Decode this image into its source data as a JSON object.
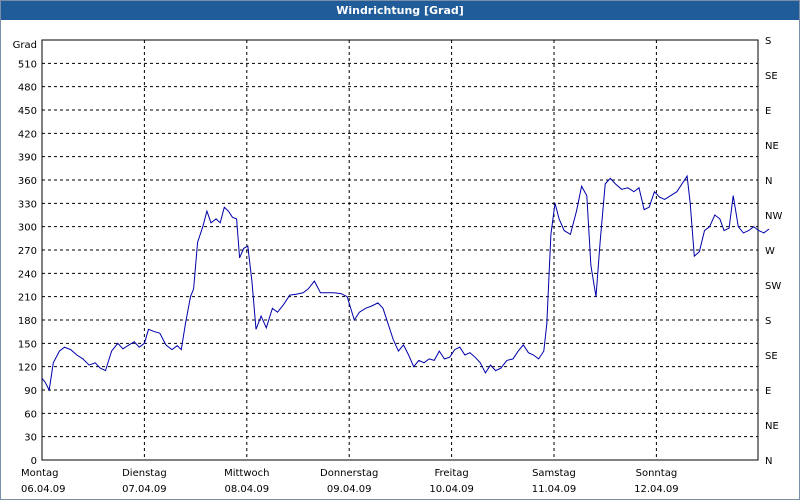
{
  "window": {
    "title": "Windrichtung [Grad]"
  },
  "chart_data": {
    "type": "line",
    "title": "Windrichtung [Grad]",
    "ylabel": "Grad",
    "ylim": [
      0,
      540
    ],
    "y_ticks": [
      0,
      30,
      60,
      90,
      120,
      150,
      180,
      210,
      240,
      270,
      300,
      330,
      360,
      390,
      420,
      450,
      480,
      510
    ],
    "y2_labels": [
      "N",
      "NE",
      "E",
      "SE",
      "S",
      "SW",
      "W",
      "NW",
      "N",
      "NE",
      "E",
      "SE",
      "S"
    ],
    "x_range": [
      0,
      7
    ],
    "x_ticks": [
      {
        "x": 0,
        "day": "Montag",
        "date": "06.04.09"
      },
      {
        "x": 1,
        "day": "Dienstag",
        "date": "07.04.09"
      },
      {
        "x": 2,
        "day": "Mittwoch",
        "date": "08.04.09"
      },
      {
        "x": 3,
        "day": "Donnerstag",
        "date": "09.04.09"
      },
      {
        "x": 4,
        "day": "Freitag",
        "date": "10.04.09"
      },
      {
        "x": 5,
        "day": "Samstag",
        "date": "11.04.09"
      },
      {
        "x": 6,
        "day": "Sonntag",
        "date": "12.04.09"
      }
    ],
    "grid": true,
    "colors": {
      "line": "#0000aa",
      "grid": "#000000",
      "titlebar": "#1f5c99"
    },
    "series": [
      {
        "points": [
          [
            0.0,
            105
          ],
          [
            0.03,
            100
          ],
          [
            0.07,
            90
          ],
          [
            0.11,
            125
          ],
          [
            0.17,
            140
          ],
          [
            0.22,
            145
          ],
          [
            0.28,
            142
          ],
          [
            0.34,
            135
          ],
          [
            0.4,
            130
          ],
          [
            0.46,
            122
          ],
          [
            0.52,
            125
          ],
          [
            0.57,
            118
          ],
          [
            0.62,
            115
          ],
          [
            0.68,
            140
          ],
          [
            0.74,
            150
          ],
          [
            0.79,
            143
          ],
          [
            0.85,
            148
          ],
          [
            0.9,
            152
          ],
          [
            0.95,
            145
          ],
          [
            1.0,
            150
          ],
          [
            1.04,
            168
          ],
          [
            1.1,
            165
          ],
          [
            1.15,
            163
          ],
          [
            1.21,
            148
          ],
          [
            1.27,
            142
          ],
          [
            1.32,
            147
          ],
          [
            1.36,
            142
          ],
          [
            1.4,
            175
          ],
          [
            1.45,
            210
          ],
          [
            1.48,
            220
          ],
          [
            1.52,
            280
          ],
          [
            1.57,
            300
          ],
          [
            1.61,
            320
          ],
          [
            1.65,
            305
          ],
          [
            1.7,
            310
          ],
          [
            1.74,
            305
          ],
          [
            1.78,
            325
          ],
          [
            1.82,
            320
          ],
          [
            1.86,
            312
          ],
          [
            1.9,
            310
          ],
          [
            1.93,
            260
          ],
          [
            1.97,
            272
          ],
          [
            2.01,
            275
          ],
          [
            2.05,
            230
          ],
          [
            2.09,
            168
          ],
          [
            2.14,
            185
          ],
          [
            2.19,
            170
          ],
          [
            2.25,
            195
          ],
          [
            2.3,
            190
          ],
          [
            2.36,
            200
          ],
          [
            2.42,
            212
          ],
          [
            2.48,
            213
          ],
          [
            2.55,
            215
          ],
          [
            2.6,
            220
          ],
          [
            2.66,
            230
          ],
          [
            2.72,
            215
          ],
          [
            2.78,
            215
          ],
          [
            2.85,
            215
          ],
          [
            2.92,
            214
          ],
          [
            2.98,
            210
          ],
          [
            3.05,
            180
          ],
          [
            3.1,
            190
          ],
          [
            3.16,
            195
          ],
          [
            3.22,
            198
          ],
          [
            3.28,
            202
          ],
          [
            3.33,
            195
          ],
          [
            3.38,
            175
          ],
          [
            3.43,
            155
          ],
          [
            3.48,
            140
          ],
          [
            3.53,
            148
          ],
          [
            3.58,
            135
          ],
          [
            3.63,
            120
          ],
          [
            3.68,
            128
          ],
          [
            3.73,
            125
          ],
          [
            3.78,
            130
          ],
          [
            3.83,
            128
          ],
          [
            3.88,
            140
          ],
          [
            3.93,
            130
          ],
          [
            3.98,
            132
          ],
          [
            4.03,
            142
          ],
          [
            4.08,
            145
          ],
          [
            4.13,
            135
          ],
          [
            4.18,
            138
          ],
          [
            4.23,
            132
          ],
          [
            4.28,
            125
          ],
          [
            4.33,
            112
          ],
          [
            4.38,
            122
          ],
          [
            4.43,
            115
          ],
          [
            4.48,
            118
          ],
          [
            4.54,
            128
          ],
          [
            4.6,
            130
          ],
          [
            4.65,
            140
          ],
          [
            4.7,
            148
          ],
          [
            4.75,
            138
          ],
          [
            4.8,
            135
          ],
          [
            4.85,
            130
          ],
          [
            4.9,
            140
          ],
          [
            4.93,
            175
          ],
          [
            4.97,
            290
          ],
          [
            5.01,
            330
          ],
          [
            5.05,
            310
          ],
          [
            5.1,
            295
          ],
          [
            5.16,
            290
          ],
          [
            5.22,
            320
          ],
          [
            5.27,
            352
          ],
          [
            5.32,
            340
          ],
          [
            5.36,
            250
          ],
          [
            5.41,
            210
          ],
          [
            5.45,
            280
          ],
          [
            5.5,
            355
          ],
          [
            5.55,
            362
          ],
          [
            5.6,
            355
          ],
          [
            5.66,
            348
          ],
          [
            5.72,
            350
          ],
          [
            5.78,
            345
          ],
          [
            5.83,
            350
          ],
          [
            5.88,
            322
          ],
          [
            5.93,
            325
          ],
          [
            5.98,
            345
          ],
          [
            6.03,
            338
          ],
          [
            6.08,
            335
          ],
          [
            6.14,
            340
          ],
          [
            6.2,
            345
          ],
          [
            6.25,
            355
          ],
          [
            6.3,
            365
          ],
          [
            6.33,
            330
          ],
          [
            6.37,
            262
          ],
          [
            6.42,
            268
          ],
          [
            6.47,
            295
          ],
          [
            6.52,
            300
          ],
          [
            6.57,
            315
          ],
          [
            6.62,
            310
          ],
          [
            6.66,
            295
          ],
          [
            6.71,
            298
          ],
          [
            6.75,
            340
          ],
          [
            6.8,
            300
          ],
          [
            6.85,
            292
          ],
          [
            6.9,
            295
          ],
          [
            6.95,
            300
          ],
          [
            7.0,
            295
          ],
          [
            7.05,
            292
          ],
          [
            7.1,
            297
          ]
        ]
      }
    ]
  }
}
